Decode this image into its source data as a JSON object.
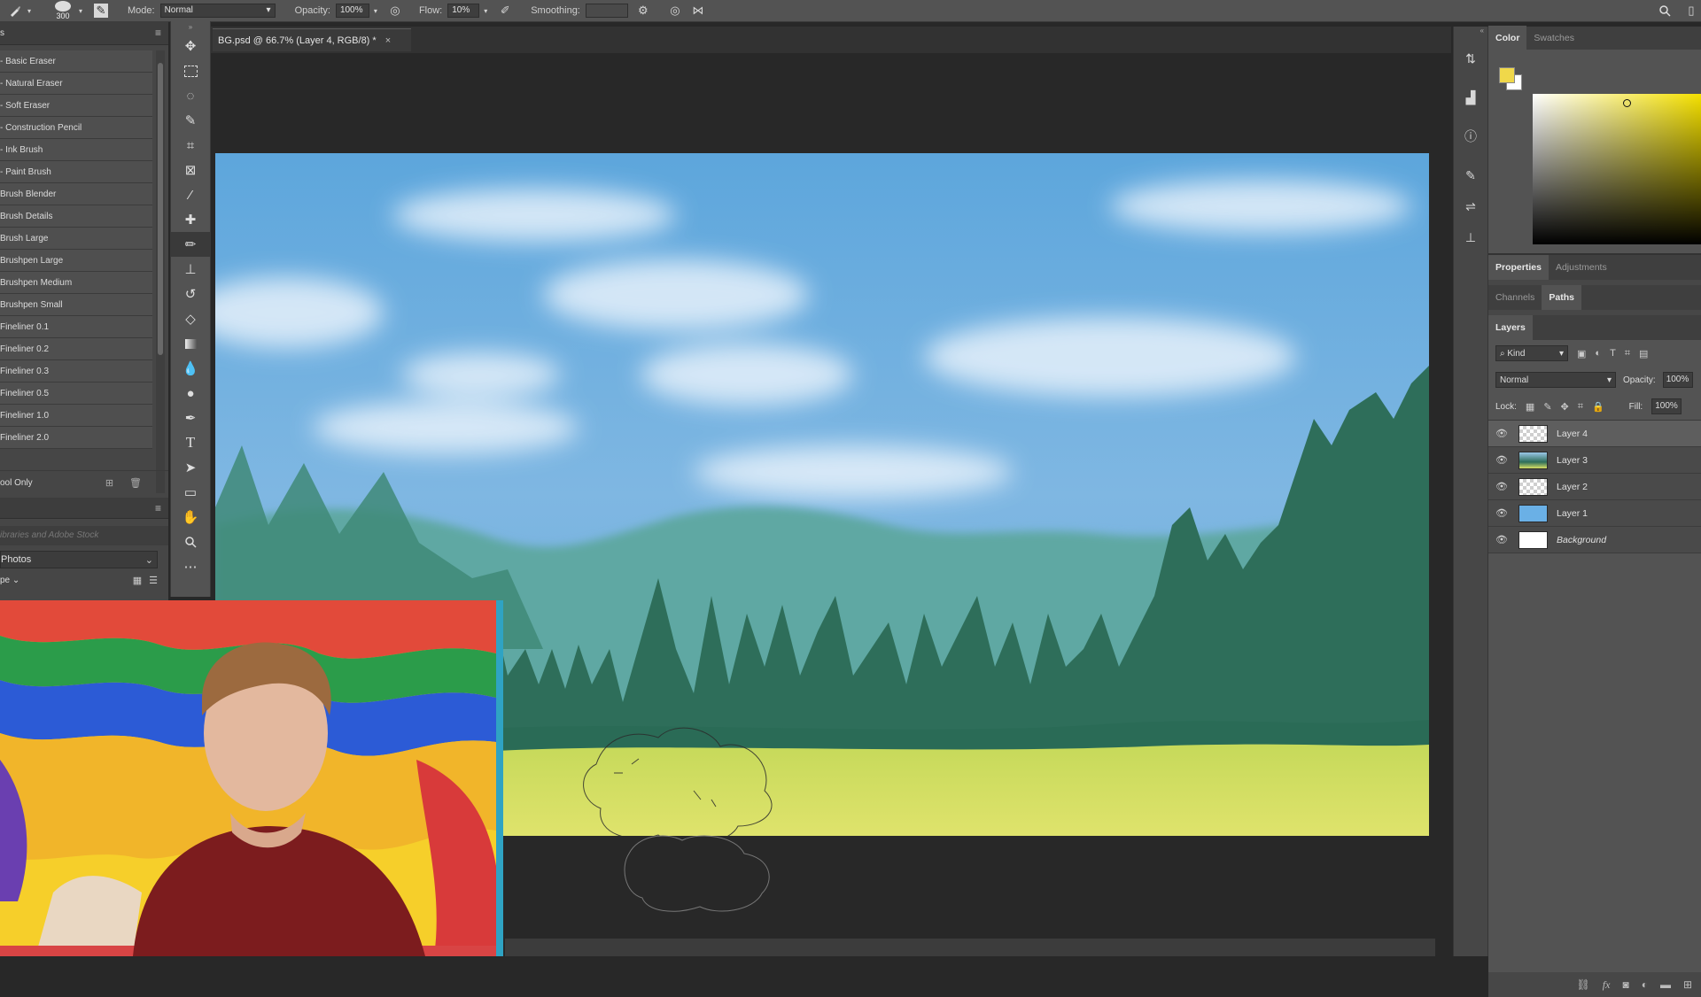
{
  "options_bar": {
    "brush_size": "300",
    "mode_label": "Mode:",
    "mode_value": "Normal",
    "opacity_label": "Opacity:",
    "opacity_value": "100%",
    "flow_label": "Flow:",
    "flow_value": "10%",
    "smoothing_label": "Smoothing:",
    "smoothing_value": ""
  },
  "left_panel": {
    "header_label": "s",
    "brushes": [
      "- Basic Eraser",
      "- Natural Eraser",
      "- Soft Eraser",
      "- Construction Pencil",
      "- Ink Brush",
      "- Paint Brush",
      "Brush Blender",
      "Brush Details",
      "Brush Large",
      "Brushpen Large",
      "Brushpen Medium",
      "Brushpen Small",
      "Fineliner 0.1",
      "Fineliner 0.2",
      "Fineliner 0.3",
      "Fineliner 0.5",
      "Fineliner 1.0",
      "Fineliner 2.0"
    ],
    "tool_only_label": "ool Only",
    "library_search_placeholder": "ibraries and Adobe Stock",
    "library_select": "Photos",
    "library_filter": "pe"
  },
  "document": {
    "tab_title": "BG.psd @ 66.7% (Layer 4, RGB/8) *",
    "close_glyph": "×"
  },
  "color_panel": {
    "tabs": [
      "Color",
      "Swatches"
    ],
    "foreground": "#f0d84a",
    "background": "#ffffff"
  },
  "properties_panel": {
    "tabs": [
      "Properties",
      "Adjustments"
    ]
  },
  "paths_panel": {
    "tabs": [
      "Channels",
      "Paths"
    ]
  },
  "layers_panel": {
    "title": "Layers",
    "filter_label": "Kind",
    "blend_mode": "Normal",
    "opacity_label": "Opacity:",
    "opacity_value": "100%",
    "lock_label": "Lock:",
    "fill_label": "Fill:",
    "fill_value": "100%",
    "layers": [
      {
        "name": "Layer 4",
        "selected": true
      },
      {
        "name": "Layer 3",
        "selected": false
      },
      {
        "name": "Layer 2",
        "selected": false
      },
      {
        "name": "Layer 1",
        "selected": false
      },
      {
        "name": "Background",
        "selected": false
      }
    ]
  },
  "colors": {
    "ui_dark": "#282828",
    "panel": "#474747",
    "sky": "#7fb7e2",
    "grass": "#d8e065",
    "trees": "#2e6e5a"
  }
}
